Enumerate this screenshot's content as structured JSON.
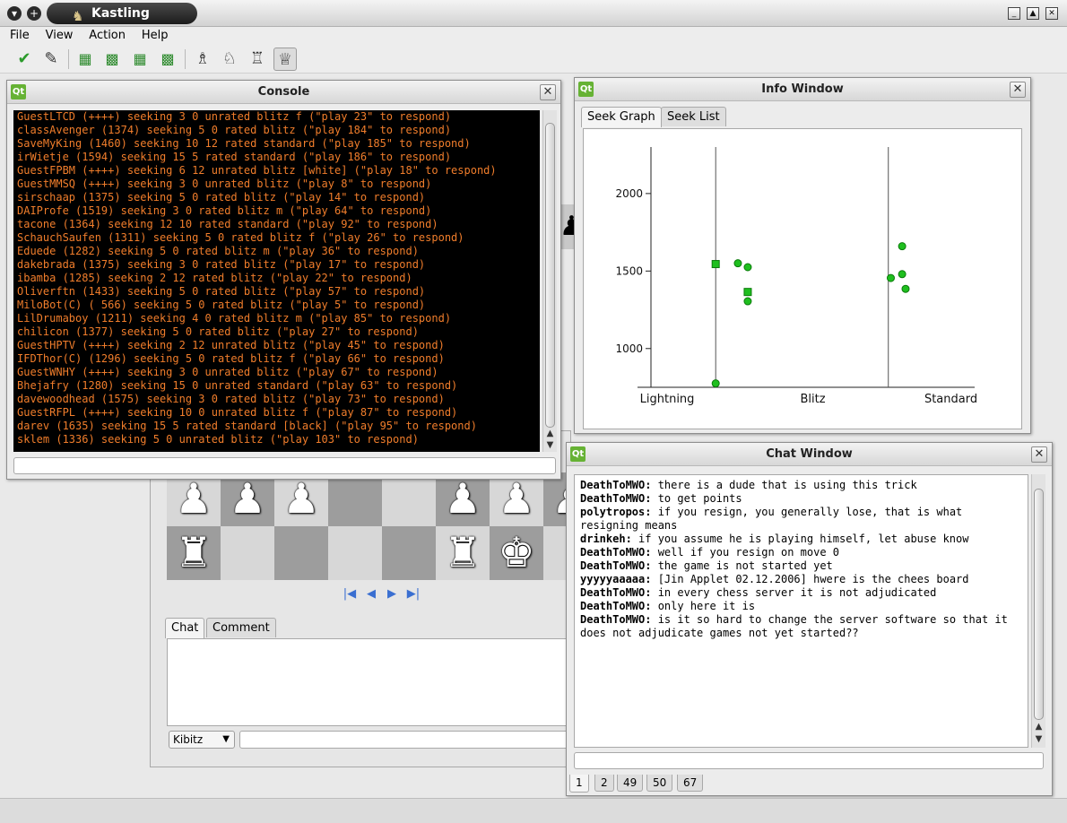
{
  "app": {
    "title": "Kastling",
    "menu": [
      "File",
      "View",
      "Action",
      "Help"
    ]
  },
  "toolbar": {
    "icons": [
      "accept-icon",
      "draw-offer-icon",
      "board-resign-icon",
      "board-flip-icon",
      "board-close-icon",
      "board-setup-icon",
      "bishop-icon",
      "knight-icon",
      "rook-icon",
      "queen-icon"
    ]
  },
  "console": {
    "title": "Console",
    "qt_label": "Qt",
    "lines": [
      "GuestLTCD (++++) seeking 3 0 unrated blitz f (\"play 23\" to respond)",
      "classAvenger (1374) seeking 5 0 rated blitz (\"play 184\" to respond)",
      "SaveMyKing (1460) seeking 10 12 rated standard (\"play 185\" to respond)",
      "irWietje (1594) seeking 15 5 rated standard (\"play 186\" to respond)",
      "GuestFPBM (++++) seeking 6 12 unrated blitz [white] (\"play 18\" to respond)",
      "GuestMMSQ (++++) seeking 3 0 unrated blitz (\"play 8\" to respond)",
      "sirschaap (1375) seeking 5 0 rated blitz (\"play 14\" to respond)",
      "DAIProfe (1519) seeking 3 0 rated blitz m (\"play 64\" to respond)",
      "tacone (1364) seeking 12 10 rated standard (\"play 92\" to respond)",
      "SchauchSaufen (1311) seeking 5 0 rated blitz f (\"play 26\" to respond)",
      "Eduede (1282) seeking 5 0 rated blitz m (\"play 36\" to respond)",
      "dakebrada (1375) seeking 3 0 rated blitz (\"play 17\" to respond)",
      "ibamba (1285) seeking 2 12 rated blitz (\"play 22\" to respond)",
      "Oliverftn (1433) seeking 5 0 rated blitz (\"play 57\" to respond)",
      "MiloBot(C) ( 566) seeking 5 0 rated blitz (\"play 5\" to respond)",
      "LilDrumaboy (1211) seeking 4 0 rated blitz m (\"play 85\" to respond)",
      "chilicon (1377) seeking 5 0 rated blitz (\"play 27\" to respond)",
      "GuestHPTV (++++) seeking 2 12 unrated blitz (\"play 45\" to respond)",
      "IFDThor(C) (1296) seeking 5 0 rated blitz f (\"play 66\" to respond)",
      "GuestWNHY (++++) seeking 3 0 unrated blitz (\"play 67\" to respond)",
      "Bhejafry (1280) seeking 15 0 unrated standard (\"play 63\" to respond)",
      "davewoodhead (1575) seeking 3 0 rated blitz (\"play 73\" to respond)",
      "GuestRFPL (++++) seeking 10 0 unrated blitz f (\"play 87\" to respond)",
      "darev (1635) seeking 15 5 rated standard [black] (\"play 95\" to respond)",
      "sklem (1336) seeking 5 0 unrated blitz (\"play 103\" to respond)"
    ],
    "input_value": ""
  },
  "info": {
    "title": "Info Window",
    "qt_label": "Qt",
    "tabs": [
      "Seek Graph",
      "Seek List"
    ],
    "active_tab": "Seek Graph"
  },
  "chart_data": {
    "type": "scatter",
    "categories": [
      "Lightning",
      "Blitz",
      "Standard"
    ],
    "yticks": [
      1000,
      1500,
      2000
    ],
    "ylim": [
      750,
      2300
    ],
    "grid": false,
    "colors": {
      "marker": "#1fbf1f",
      "marker_edge": "#0a7a0a"
    },
    "points": [
      {
        "category": "Blitz",
        "offset": 0.0,
        "rating": 1545,
        "shape": "square"
      },
      {
        "category": "Blitz",
        "offset": 0.45,
        "rating": 1550,
        "shape": "circle"
      },
      {
        "category": "Blitz",
        "offset": 0.65,
        "rating": 1525,
        "shape": "circle"
      },
      {
        "category": "Blitz",
        "offset": 0.65,
        "rating": 1365,
        "shape": "square"
      },
      {
        "category": "Blitz",
        "offset": 0.65,
        "rating": 1305,
        "shape": "circle"
      },
      {
        "category": "Blitz",
        "offset": 0.0,
        "rating": 775,
        "shape": "circle"
      },
      {
        "category": "Standard",
        "offset": 0.05,
        "rating": 1455,
        "shape": "circle"
      },
      {
        "category": "Standard",
        "offset": 0.28,
        "rating": 1660,
        "shape": "circle"
      },
      {
        "category": "Standard",
        "offset": 0.28,
        "rating": 1480,
        "shape": "circle"
      },
      {
        "category": "Standard",
        "offset": 0.35,
        "rating": 1385,
        "shape": "circle"
      }
    ]
  },
  "chat": {
    "title": "Chat Window",
    "qt_label": "Qt",
    "messages": [
      {
        "from": "DeathToMWO:",
        "text": " there is a dude that is using this trick"
      },
      {
        "from": "DeathToMWO:",
        "text": " to get points"
      },
      {
        "from": "polytropos:",
        "text": " if you resign, you generally lose, that is what resigning means"
      },
      {
        "from": "drinkeh:",
        "text": " if you assume he is playing himself, let abuse know"
      },
      {
        "from": "DeathToMWO:",
        "text": " well if you resign on move 0"
      },
      {
        "from": "DeathToMWO:",
        "text": " the game is not started yet"
      },
      {
        "from": "yyyyyaaaaa:",
        "text": " [Jin Applet 02.12.2006] hwere is the chees board"
      },
      {
        "from": "DeathToMWO:",
        "text": " in every chess server it is not adjudicated"
      },
      {
        "from": "DeathToMWO:",
        "text": " only here it is"
      },
      {
        "from": "DeathToMWO:",
        "text": " is it so hard to change the server software so that it does not adjudicate games not yet started??"
      }
    ],
    "input_value": "",
    "channel_tabs": [
      "1",
      "2",
      "49",
      "50",
      "67"
    ],
    "active_channel": "1"
  },
  "game": {
    "tabs": [
      "Chat",
      "Comment"
    ],
    "active_tab": "Chat",
    "kibitz_value": "Kibitz",
    "input_value": "",
    "nav_icons": [
      "first-move-icon",
      "previous-move-icon",
      "next-move-icon",
      "last-move-icon"
    ]
  }
}
